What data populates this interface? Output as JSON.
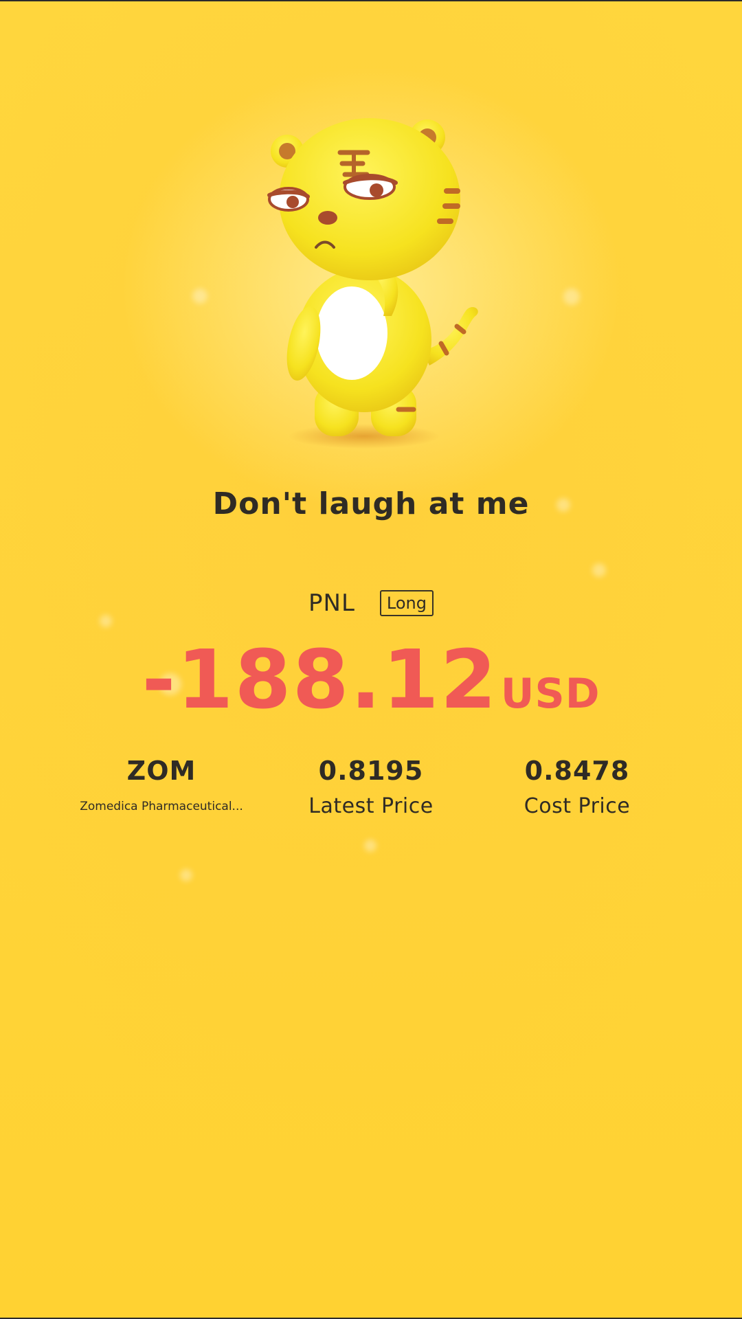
{
  "headline": "Don't laugh at me",
  "pnl": {
    "label": "PNL",
    "direction": "Long",
    "value": "-188.12",
    "unit": "USD",
    "color": "#f05a55"
  },
  "stock": {
    "symbol": "ZOM",
    "name": "Zomedica Pharmaceutical..."
  },
  "latest": {
    "value": "0.8195",
    "label": "Latest Price"
  },
  "cost": {
    "value": "0.8478",
    "label": "Cost Price"
  },
  "mascot": {
    "icon": "tiger-mascot-icon"
  },
  "colors": {
    "background": "#ffd43a",
    "text": "#2f2b25"
  }
}
